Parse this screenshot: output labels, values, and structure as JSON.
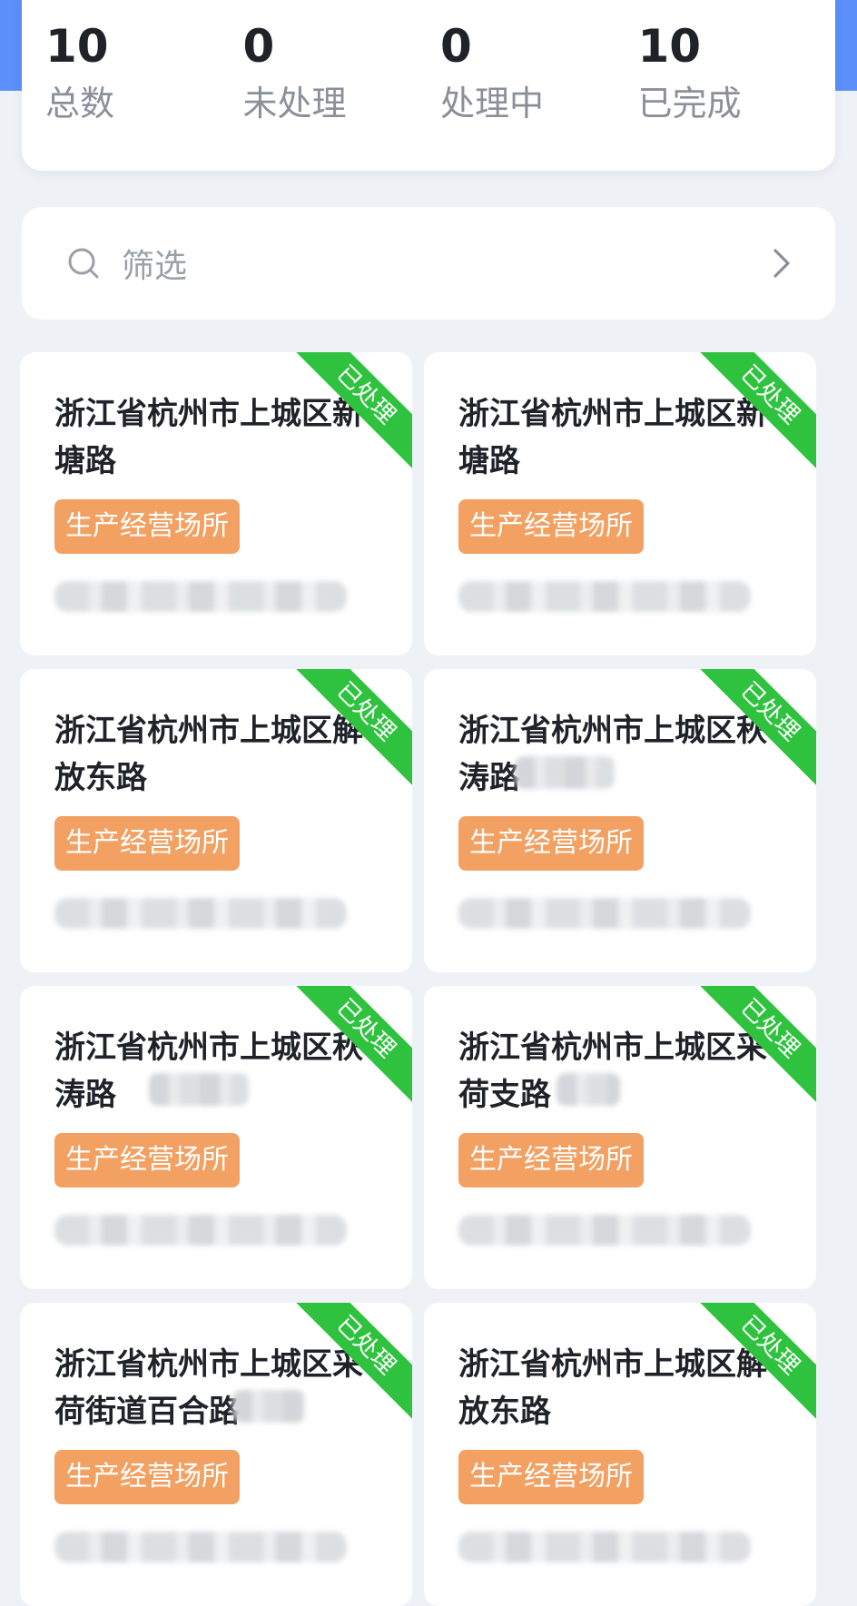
{
  "stats": [
    {
      "value": "10",
      "label": "总数"
    },
    {
      "value": "0",
      "label": "未处理"
    },
    {
      "value": "0",
      "label": "处理中"
    },
    {
      "value": "10",
      "label": "已完成"
    }
  ],
  "filter": {
    "label": "筛选",
    "icon": "search-icon",
    "chevron": "chevron-right-icon"
  },
  "colors": {
    "accent": "#5b8ff9",
    "tag": "#f3a162",
    "ribbon": "#2ec23e"
  },
  "cards": [
    {
      "address": "浙江省杭州市上城区新塘路",
      "tag": "生产经营场所",
      "status": "已处理"
    },
    {
      "address": "浙江省杭州市上城区新塘路",
      "tag": "生产经营场所",
      "status": "已处理"
    },
    {
      "address": "浙江省杭州市上城区解放东路",
      "tag": "生产经营场所",
      "status": "已处理"
    },
    {
      "address": "浙江省杭州市上城区秋涛路",
      "tag": "生产经营场所",
      "status": "已处理"
    },
    {
      "address": "浙江省杭州市上城区秋涛路",
      "tag": "生产经营场所",
      "status": "已处理"
    },
    {
      "address": "浙江省杭州市上城区采荷支路",
      "tag": "生产经营场所",
      "status": "已处理"
    },
    {
      "address": "浙江省杭州市上城区采荷街道百合路",
      "tag": "生产经营场所",
      "status": "已处理"
    },
    {
      "address": "浙江省杭州市上城区解放东路",
      "tag": "生产经营场所",
      "status": "已处理"
    }
  ]
}
